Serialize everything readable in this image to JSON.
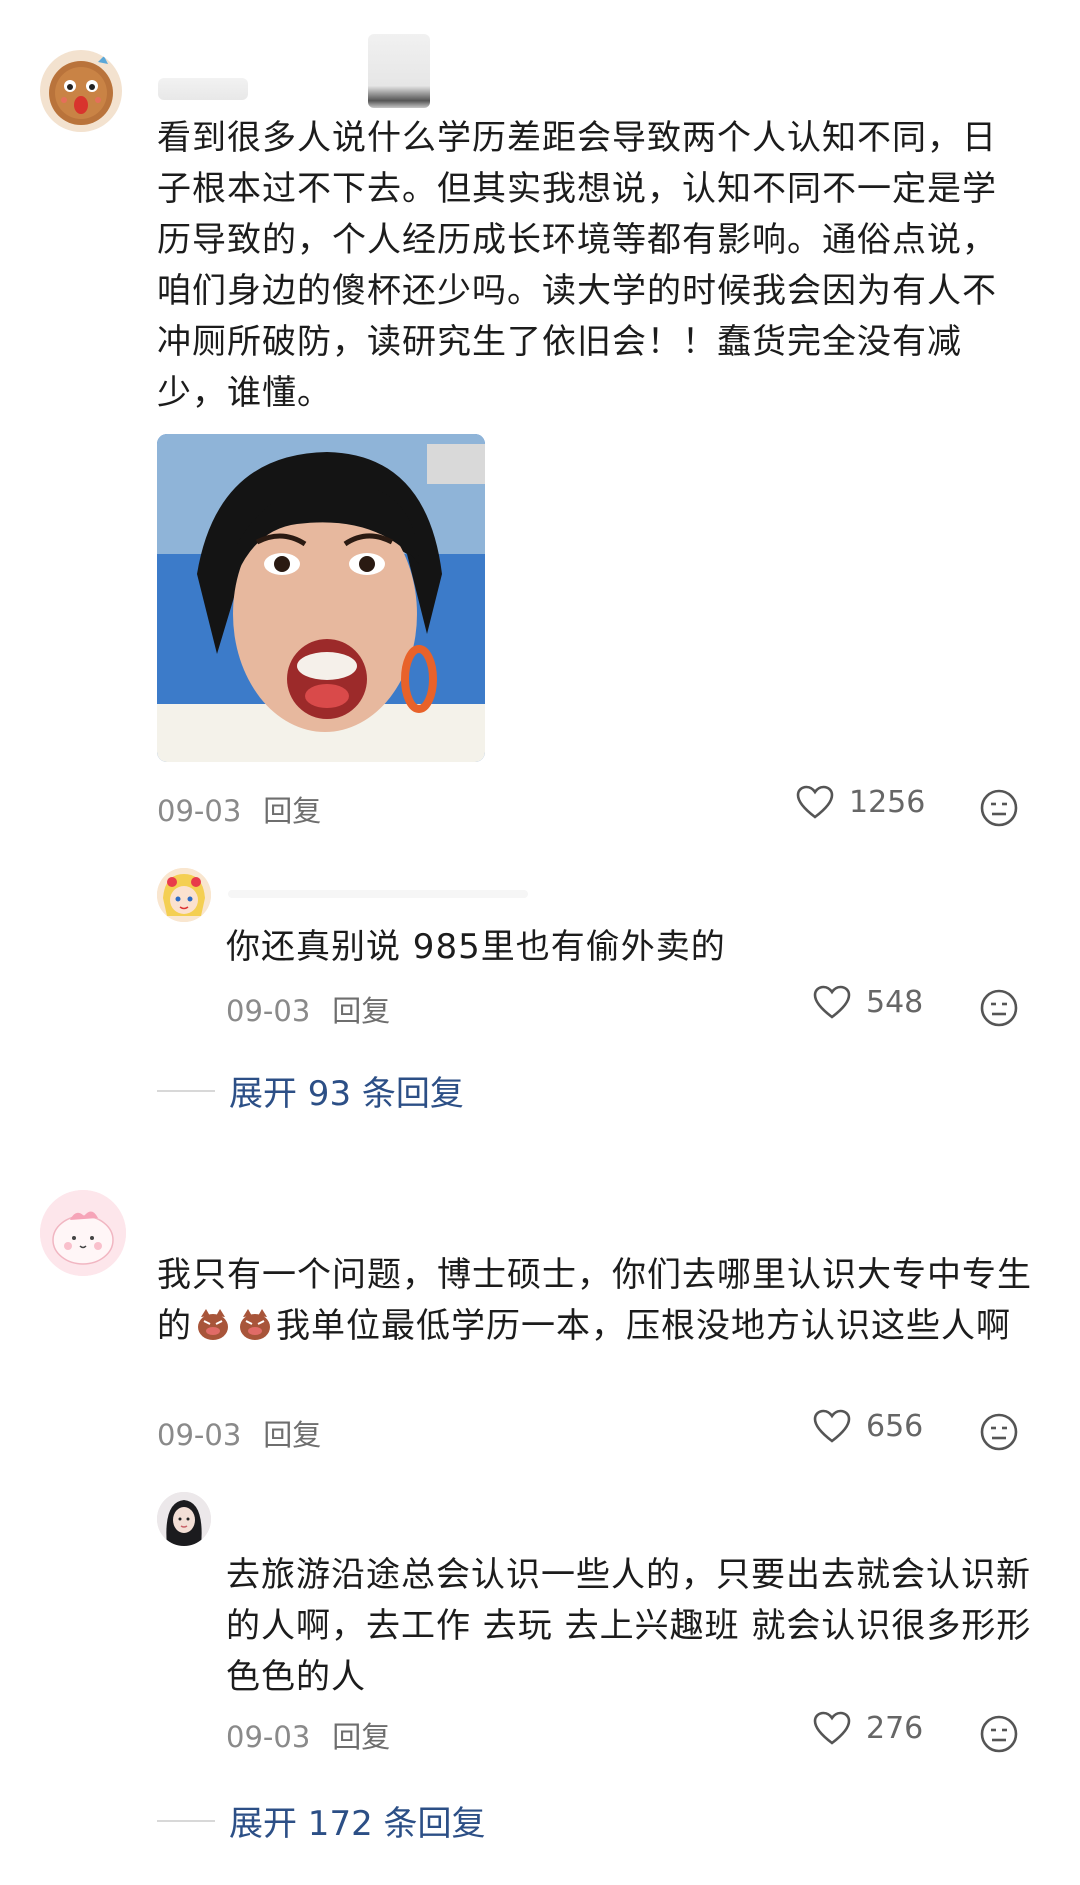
{
  "colors": {
    "link": "#2c4f86",
    "meta": "#8a8a8a",
    "text": "#1c1c1c",
    "reply_action": "#6e6e6e"
  },
  "comments": [
    {
      "text": "看到很多人说什么学历差距会导致两个人认知不同，日子根本过不下去。但其实我想说，认知不同不一定是学历导致的，个人经历成长环境等都有影响。通俗点说，咱们身边的傻杯还少吗。读大学的时候我会因为有人不冲厕所破防，读研究生了依旧会！！蠢货完全没有减少，谁懂。",
      "date": "09-03",
      "reply_label": "回复",
      "likes": "1256",
      "reply": {
        "text": "你还真别说 985里也有偷外卖的",
        "date": "09-03",
        "reply_label": "回复",
        "likes": "548"
      },
      "expand_label": "展开 93 条回复"
    },
    {
      "text_parts": [
        "我只有一个问题，博士硕士，你们去哪里认识大专中专生的",
        "我单位最低学历一本，压根没地方认识这些人啊"
      ],
      "date": "09-03",
      "reply_label": "回复",
      "likes": "656",
      "reply": {
        "text": "去旅游沿途总会认识一些人的，只要出去就会认识新的人啊，去工作 去玩 去上兴趣班 就会认识很多形形色色的人",
        "date": "09-03",
        "reply_label": "回复",
        "likes": "276"
      },
      "expand_label": "展开 172 条回复"
    }
  ],
  "icons": {
    "like": "heart-outline-icon",
    "more": "emoji-face-icon",
    "inline_emoji": "angry-pig-emoji"
  }
}
